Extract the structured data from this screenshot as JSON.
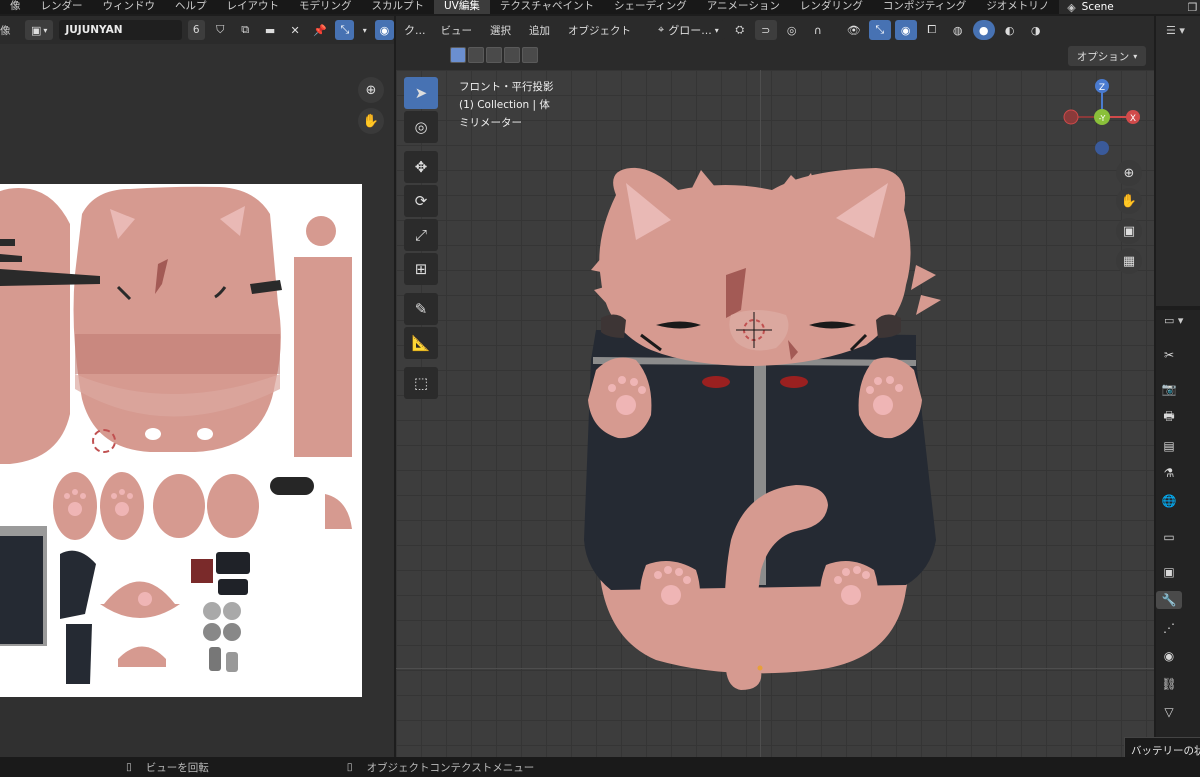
{
  "topbar": {
    "tabs": [
      "像",
      "レンダー",
      "ウィンドウ",
      "ヘルプ",
      "レイアウト",
      "モデリング",
      "スカルプト",
      "UV編集",
      "テクスチャペイント",
      "シェーディング",
      "アニメーション",
      "レンダリング",
      "コンポジティング",
      "ジオメトリノ"
    ],
    "active_tab": "UV編集",
    "scene_label": "Scene"
  },
  "uv_editor": {
    "header_label": "像",
    "image_name": "JUJUNYAN",
    "user_count": "6"
  },
  "viewport": {
    "menus": [
      "ビュー",
      "選択",
      "追加",
      "オブジェクト"
    ],
    "transform_orientation": "グロー...",
    "options_label": "オプション",
    "view_name": "フロント・平行投影",
    "collection_line": "(1) Collection | 体",
    "unit_line": "ミリメーター",
    "editor_mode_label": "ク..."
  },
  "gizmo": {
    "z_label": "Z",
    "y_label": "-Y",
    "x_label": "X"
  },
  "statusbar": {
    "left_hint": "ビューを回転",
    "right_hint": "オブジェクトコンテクストメニュー"
  },
  "tooltip": {
    "text": "バッテリーの状"
  },
  "colors": {
    "accent_blue": "#4772b3",
    "cat_pink": "#d69a90",
    "cat_dark": "#252a33",
    "viewport_bg": "#3d3d3d"
  }
}
